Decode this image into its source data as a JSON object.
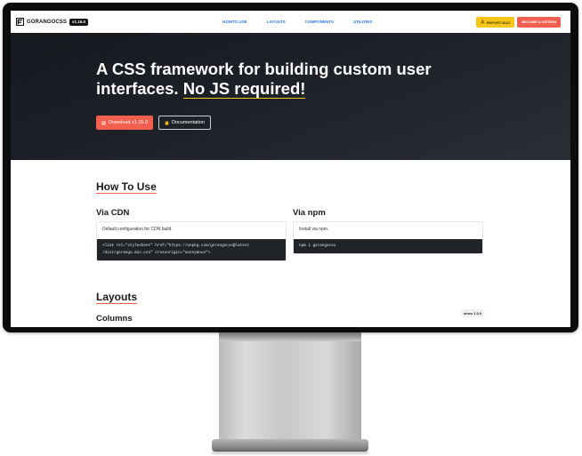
{
  "navbar": {
    "brand_name": "GORANGOCSS",
    "version": "v1.15.0",
    "links": [
      "HOWTO USE",
      "LAYOUTS",
      "COMPONENTS",
      "UTILITIES"
    ],
    "report_bug": "REPORT BUG",
    "become_patron": "BECOME A PATRON"
  },
  "hero": {
    "title_line1": "A CSS framework for building custom user",
    "title_line2a": "interfaces. ",
    "title_line2b": "No JS required!",
    "download_label": "Download v1.15.0",
    "docs_label": "Documentation"
  },
  "how_to_use": {
    "title": "How To Use",
    "cdn": {
      "title": "Via CDN",
      "description": "Default configuration for CDN build.",
      "code_line1": "<link rel=\"stylesheet\" href=\"https://unpkg.com/gorangocss@latest",
      "code_line2": "/dist/gorango.min.css\" crossorigin=\"anonymous\">"
    },
    "npm": {
      "title": "Via npm",
      "description": "Install via npm.",
      "code_line1": "npm i gorangocss"
    }
  },
  "layouts": {
    "title": "Layouts",
    "columns_title": "Columns",
    "since_badge": "since 1.0.0"
  },
  "colors": {
    "accent_red": "#f35f4f",
    "accent_yellow": "#f5c518",
    "link_blue": "#2a7ae2",
    "hero_dark": "#1c1f24"
  }
}
